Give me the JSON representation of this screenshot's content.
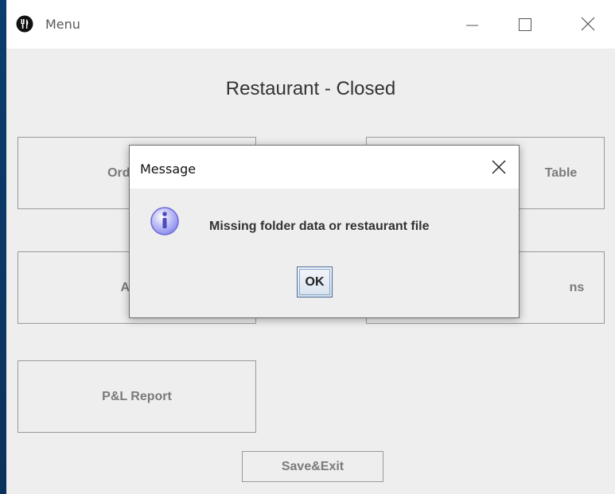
{
  "window": {
    "title": "Menu",
    "icon": "fork-knife-icon"
  },
  "main": {
    "heading": "Restaurant - Closed",
    "buttons": {
      "order_food": "Order Fro",
      "table": "Table",
      "add": "Add",
      "options": "ns",
      "pl_report": "P&L Report",
      "save_exit": "Save&Exit"
    }
  },
  "dialog": {
    "title": "Message",
    "icon": "info-icon",
    "message": "Missing folder data or restaurant file",
    "ok_label": "OK"
  },
  "colors": {
    "accent": "#0b3d6e",
    "window_bg": "#eeeeee",
    "button_border": "#9a9a9a",
    "info_icon": "#8e8ef0"
  }
}
